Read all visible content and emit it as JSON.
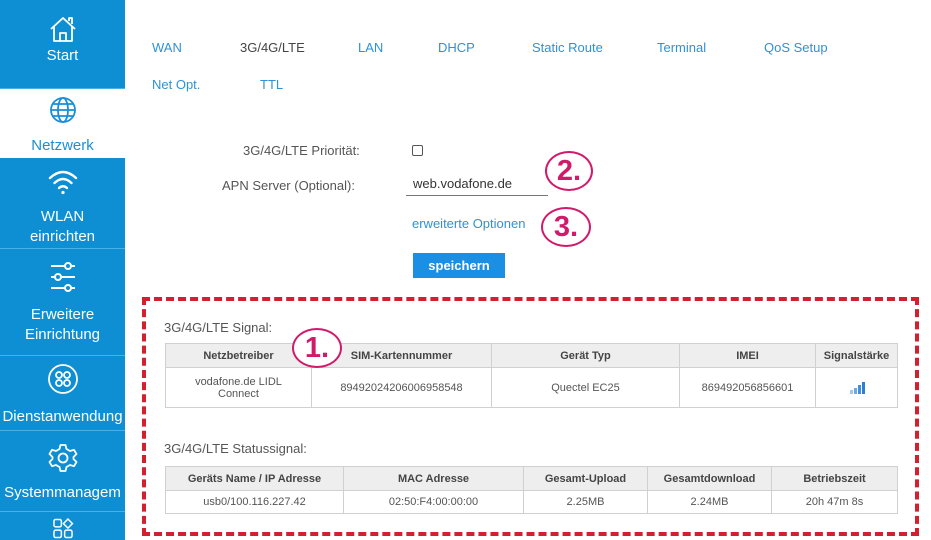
{
  "sidebar": {
    "items": [
      {
        "label": "Start",
        "icon": "home-icon"
      },
      {
        "label": "Netzwerk",
        "icon": "globe-icon",
        "active": true
      },
      {
        "label": "WLAN einrichten",
        "label_line1": "WLAN",
        "label_line2": "einrichten",
        "icon": "wifi-icon"
      },
      {
        "label": "Erweitere Einrichtung",
        "label_line1": "Erweitere",
        "label_line2": "Einrichtung",
        "icon": "sliders-icon"
      },
      {
        "label": "Dienstanwendung",
        "icon": "apps-icon"
      },
      {
        "label": "Systemmanagem",
        "icon": "gear-icon"
      },
      {
        "label": "",
        "icon": "grid-icon"
      }
    ]
  },
  "tabs": [
    "WAN",
    "3G/4G/LTE",
    "LAN",
    "DHCP",
    "Static Route",
    "Terminal",
    "QoS Setup",
    "Net Opt.",
    "TTL"
  ],
  "form": {
    "priority_label": "3G/4G/LTE Priorität:",
    "priority_checked": false,
    "apn_label": "APN Server (Optional):",
    "apn_value": "web.vodafone.de",
    "advanced_link": "erweiterte Optionen",
    "save_label": "speichern"
  },
  "markers": [
    "1.",
    "2.",
    "3."
  ],
  "signal_section": {
    "title": "3G/4G/LTE Signal:",
    "headers": [
      "Netzbetreiber",
      "SIM-Kartennummer",
      "Gerät Typ",
      "IMEI",
      "Signalstärke"
    ],
    "row": {
      "operator": "vodafone.de LIDL Connect",
      "operator_line1": "vodafone.de LIDL",
      "operator_line2": "Connect",
      "sim": "89492024206006958548",
      "device": "Quectel EC25",
      "imei": "869492056856601",
      "signal_icon": "signal-bars-icon"
    }
  },
  "status_section": {
    "title": "3G/4G/LTE Statussignal:",
    "headers": [
      "Geräts Name / IP Adresse",
      "MAC Adresse",
      "Gesamt-Upload",
      "Gesamtdownload",
      "Betriebszeit"
    ],
    "row": {
      "name_ip": "usb0/100.116.227.42",
      "mac": "02:50:F4:00:00:00",
      "upload": "2.25MB",
      "download": "2.24MB",
      "uptime": "20h 47m 8s"
    }
  },
  "colors": {
    "sidebar_bg": "#0e8fd3",
    "accent": "#2d92d6",
    "marker": "#d11a6a",
    "dash_border": "#d2202f"
  }
}
